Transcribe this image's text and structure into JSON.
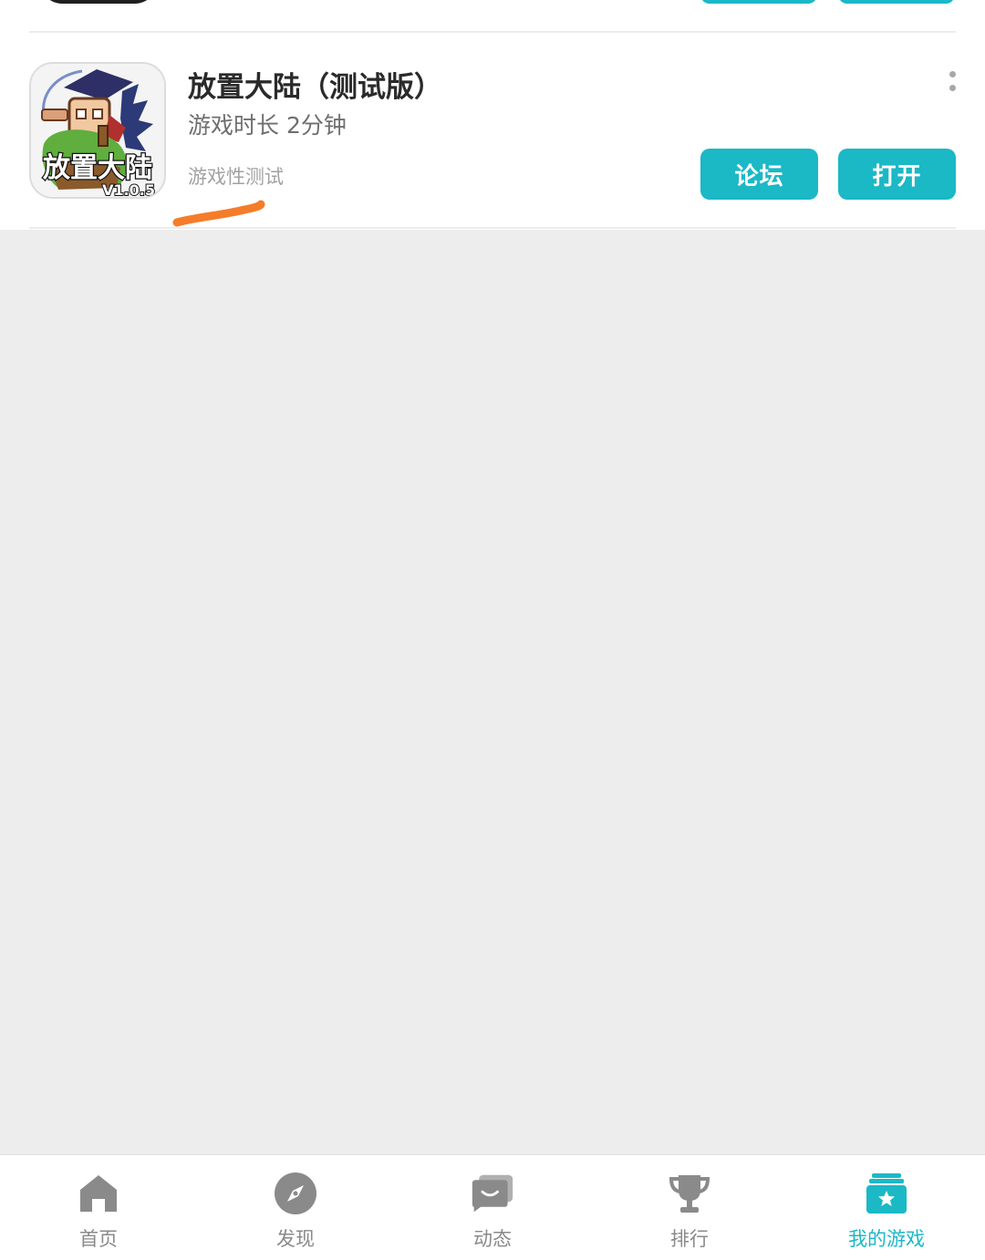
{
  "game": {
    "title": "放置大陆（测试版）",
    "play_time": "游戏时长 2分钟",
    "tag": "游戏性测试",
    "icon_title": "放置大陆",
    "icon_version": "V1.0.5",
    "forum_label": "论坛",
    "open_label": "打开"
  },
  "tabs": [
    {
      "label": "首页",
      "icon": "home-icon",
      "active": false
    },
    {
      "label": "发现",
      "icon": "compass-icon",
      "active": false
    },
    {
      "label": "动态",
      "icon": "chat-icon",
      "active": false
    },
    {
      "label": "排行",
      "icon": "trophy-icon",
      "active": false
    },
    {
      "label": "我的游戏",
      "icon": "my-games-icon",
      "active": true
    }
  ],
  "colors": {
    "accent": "#1bb8c6",
    "annotation": "#f57c2a",
    "background": "#ededed",
    "tab_inactive": "#8a8a8a"
  }
}
